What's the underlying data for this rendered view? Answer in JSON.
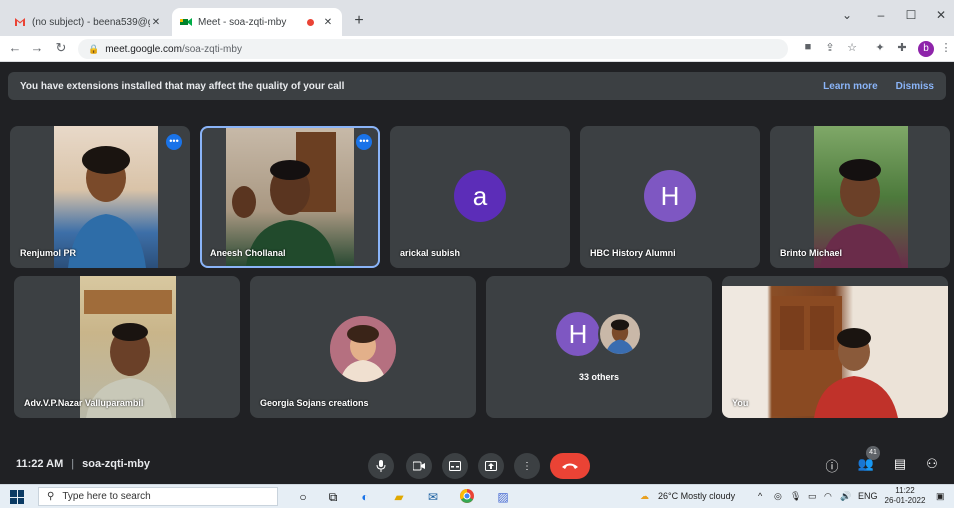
{
  "browser": {
    "tabs": [
      {
        "title": "(no subject) - beena539@gmail.c",
        "close": "✕"
      },
      {
        "title": "Meet - soa-zqti-mby",
        "close": "✕"
      }
    ],
    "new_tab": "+",
    "window_controls": {
      "menu": "⌄",
      "minimize": "–",
      "maximize": "☐",
      "close": "✕"
    },
    "url_host": "meet.google.com",
    "url_path": "/soa-zqti-mby",
    "profile_initial": "b"
  },
  "meet": {
    "banner": {
      "message": "You have extensions installed that may affect the quality of your call",
      "learn_more": "Learn more",
      "dismiss": "Dismiss"
    },
    "participants": [
      {
        "name": "Renjumol PR"
      },
      {
        "name": "Aneesh Chollanal"
      },
      {
        "name": "arickal subish",
        "initial": "a",
        "color": "#5c2db8"
      },
      {
        "name": "HBC History Alumni",
        "initial": "H",
        "color": "#7e57c2"
      },
      {
        "name": "Brinto Michael"
      },
      {
        "name": "Adv.V.P.Nazar Valluparambil"
      },
      {
        "name": "Georgia Sojans creations"
      },
      {
        "others_initial": "H",
        "others_label": "33 others",
        "color": "#7e57c2"
      },
      {
        "name": "You"
      }
    ],
    "time": "11:22 AM",
    "meeting_code": "soa-zqti-mby",
    "participant_count": "41"
  },
  "taskbar": {
    "search_placeholder": "Type here to search",
    "weather": "26°C  Mostly cloudy",
    "language": "ENG",
    "time": "11:22",
    "date": "26-01-2022"
  }
}
